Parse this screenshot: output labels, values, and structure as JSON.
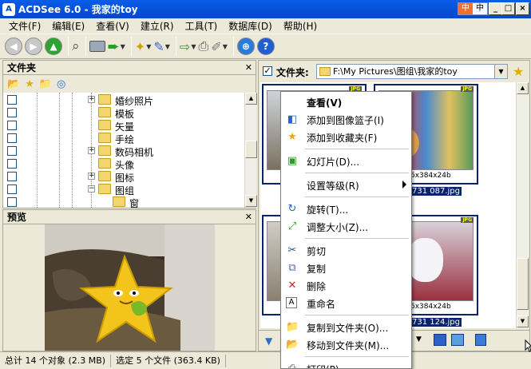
{
  "window": {
    "title": "ACDSee 6.0 - 我家的toy",
    "ime": [
      "中",
      "中"
    ]
  },
  "menu": [
    "文件(F)",
    "编辑(E)",
    "查看(V)",
    "建立(R)",
    "工具(T)",
    "数据库(D)",
    "帮助(H)"
  ],
  "folder_pane": {
    "title": "文件夹",
    "tree": [
      {
        "label": "婚纱照片",
        "expandable": true
      },
      {
        "label": "模板",
        "expandable": false
      },
      {
        "label": "矢量",
        "expandable": false
      },
      {
        "label": "手绘",
        "expandable": false
      },
      {
        "label": "数码相机",
        "expandable": true
      },
      {
        "label": "头像",
        "expandable": false
      },
      {
        "label": "图标",
        "expandable": true
      },
      {
        "label": "图组",
        "expandable": false
      },
      {
        "label": "窗",
        "expandable": false
      }
    ]
  },
  "preview_pane": {
    "title": "预览"
  },
  "browser": {
    "folder_label": "文件夹:",
    "path": "F:\\My Pictures\\图组\\我家的toy",
    "thumbs": [
      {
        "badge": "JPG",
        "dims": "",
        "name": ""
      },
      {
        "badge": "JPG",
        "dims": "6x384x24b",
        "name": "731 087.jpg"
      },
      {
        "badge": "",
        "dims": "",
        "name": ""
      },
      {
        "badge": "JPG",
        "dims": "6x384x24b",
        "name": "731 124.jpg"
      }
    ]
  },
  "status": {
    "total": "总计 14 个对象 (2.3 MB)",
    "selected": "选定 5 个文件 (363.4 KB)"
  },
  "context_menu": [
    {
      "label": "查看(V)",
      "icon": ""
    },
    {
      "label": "添加到图像篮子(I)",
      "icon": "basket-icon"
    },
    {
      "label": "添加到收藏夹(F)",
      "icon": "star-icon"
    },
    {
      "sep": true
    },
    {
      "label": "幻灯片(D)...",
      "icon": "slideshow-icon"
    },
    {
      "sep": true
    },
    {
      "label": "设置等级(R)",
      "icon": "",
      "submenu": true
    },
    {
      "sep": true
    },
    {
      "label": "旋转(T)...",
      "icon": "rotate-icon"
    },
    {
      "label": "调整大小(Z)...",
      "icon": "resize-icon"
    },
    {
      "sep": true
    },
    {
      "label": "剪切",
      "icon": "scissors-icon"
    },
    {
      "label": "复制",
      "icon": "copy-icon"
    },
    {
      "label": "删除",
      "icon": "delete-icon"
    },
    {
      "label": "重命名",
      "icon": "rename-icon"
    },
    {
      "sep": true
    },
    {
      "label": "复制到文件夹(O)...",
      "icon": "copy-to-folder-icon"
    },
    {
      "label": "移动到文件夹(M)...",
      "icon": "move-to-folder-icon"
    },
    {
      "sep": true
    },
    {
      "label": "打印(P)...",
      "icon": "print-icon"
    }
  ]
}
